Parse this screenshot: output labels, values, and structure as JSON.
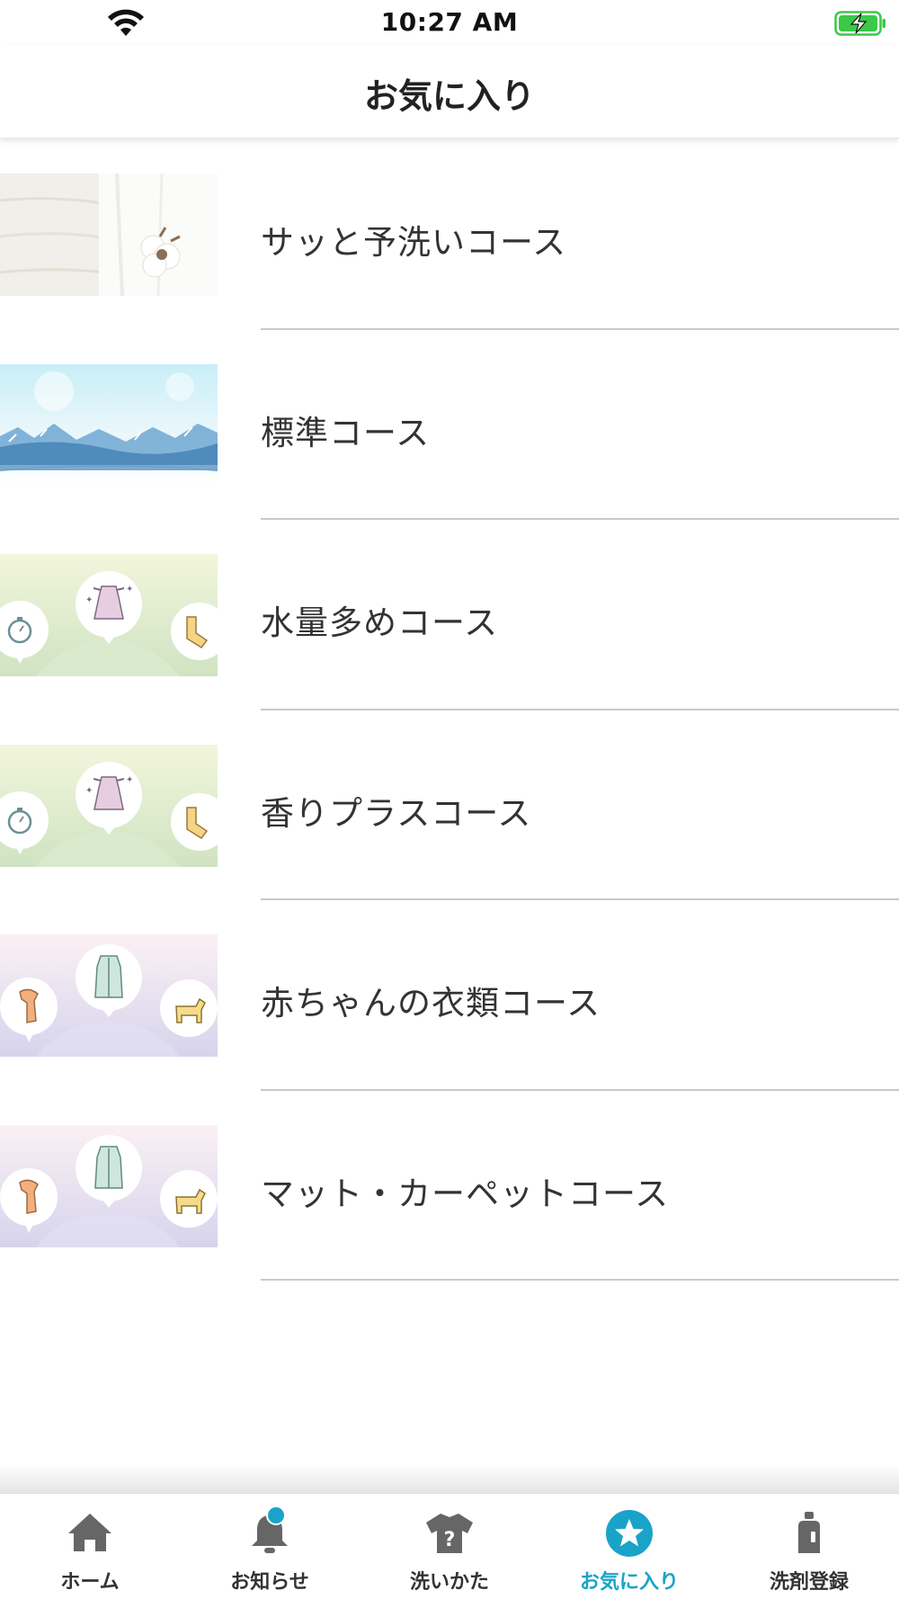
{
  "status_bar": {
    "time": "10:27 AM"
  },
  "header": {
    "title": "お気に入り"
  },
  "courses": [
    {
      "label": "サッと予洗いコース",
      "thumbnail": "cotton-on-white-fabric"
    },
    {
      "label": "標準コース",
      "thumbnail": "water-splash"
    },
    {
      "label": "水量多めコース",
      "thumbnail": "dress-stopwatch-sock-bubbles"
    },
    {
      "label": "香りプラスコース",
      "thumbnail": "dress-stopwatch-sock-bubbles"
    },
    {
      "label": "赤ちゃんの衣類コース",
      "thumbnail": "coat-scarf-dog-bubbles"
    },
    {
      "label": "マット・カーペットコース",
      "thumbnail": "coat-scarf-dog-bubbles"
    }
  ],
  "tab_bar": {
    "tabs": [
      {
        "label": "ホーム",
        "icon": "home-icon",
        "active": false
      },
      {
        "label": "お知らせ",
        "icon": "bell-icon",
        "active": false,
        "badge": true
      },
      {
        "label": "洗いかた",
        "icon": "shirt-question-icon",
        "active": false
      },
      {
        "label": "お気に入り",
        "icon": "star-circle-icon",
        "active": true
      },
      {
        "label": "洗剤登録",
        "icon": "detergent-bottle-icon",
        "active": false
      }
    ]
  },
  "colors": {
    "accent": "#1aa3c8",
    "tab_inactive": "#666666",
    "battery_green": "#3cc84a",
    "divider": "#c9c9c9"
  }
}
